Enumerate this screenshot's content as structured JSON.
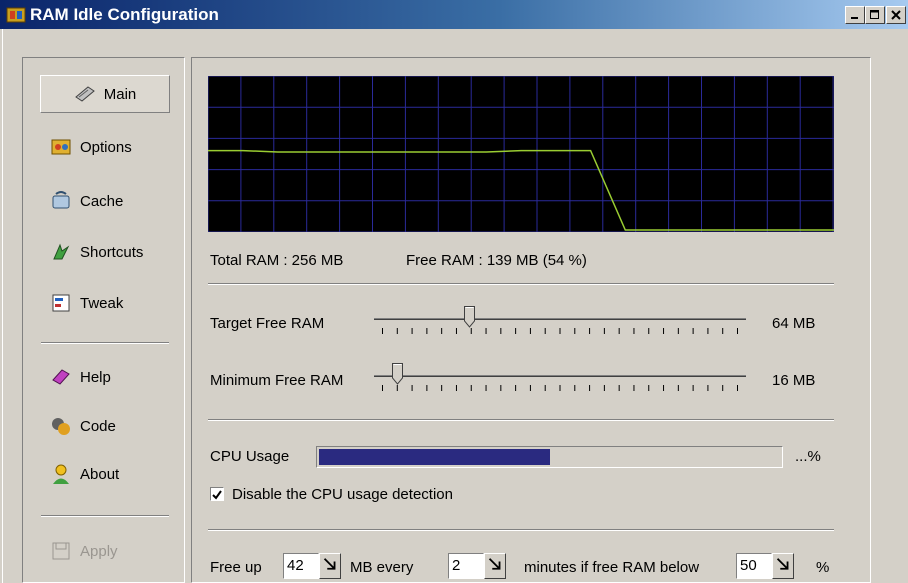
{
  "window": {
    "title": "RAM Idle Configuration"
  },
  "sidebar": {
    "items": [
      {
        "label": "Main",
        "icon": "memory-chip-icon",
        "selected": true
      },
      {
        "label": "Options",
        "icon": "options-icon"
      },
      {
        "label": "Cache",
        "icon": "cache-icon"
      },
      {
        "label": "Shortcuts",
        "icon": "shortcuts-icon"
      },
      {
        "label": "Tweak",
        "icon": "tweak-icon"
      },
      {
        "label": "Help",
        "icon": "help-book-icon"
      },
      {
        "label": "Code",
        "icon": "code-icon"
      },
      {
        "label": "About",
        "icon": "about-person-icon"
      }
    ],
    "apply": {
      "label": "Apply",
      "icon": "floppy-disk-icon",
      "enabled": false
    }
  },
  "graph": {
    "free_ram_series": [
      0.55,
      0.55,
      0.54,
      0.54,
      0.54,
      0.54,
      0.54,
      0.54,
      0.54,
      0.55,
      0.55,
      0.55,
      0.0,
      0.0,
      0.0,
      0.0,
      0.0,
      0.0,
      0.0
    ],
    "line_color": "#9acd32",
    "grid_color": "#2a2a9a"
  },
  "stats": {
    "total_ram": "Total RAM : 256 MB",
    "free_ram": "Free RAM : 139 MB (54 %)"
  },
  "target_free": {
    "label": "Target Free RAM",
    "value": "64 MB",
    "position": 0.25
  },
  "minimum_free": {
    "label": "Minimum Free RAM",
    "value": "16 MB",
    "position": 0.05
  },
  "cpu": {
    "label": "CPU Usage",
    "suffix": "...%",
    "fill": 0.5,
    "bar_color": "#2a2a80"
  },
  "disable_cpu": {
    "label": "Disable the CPU usage detection",
    "checked": true
  },
  "freeup": {
    "prefix": "Free up",
    "mb_value": "42",
    "mb_label": "MB every",
    "minutes_value": "2",
    "minutes_label": "minutes if free RAM below",
    "percent_value": "50",
    "percent_label": "%"
  }
}
